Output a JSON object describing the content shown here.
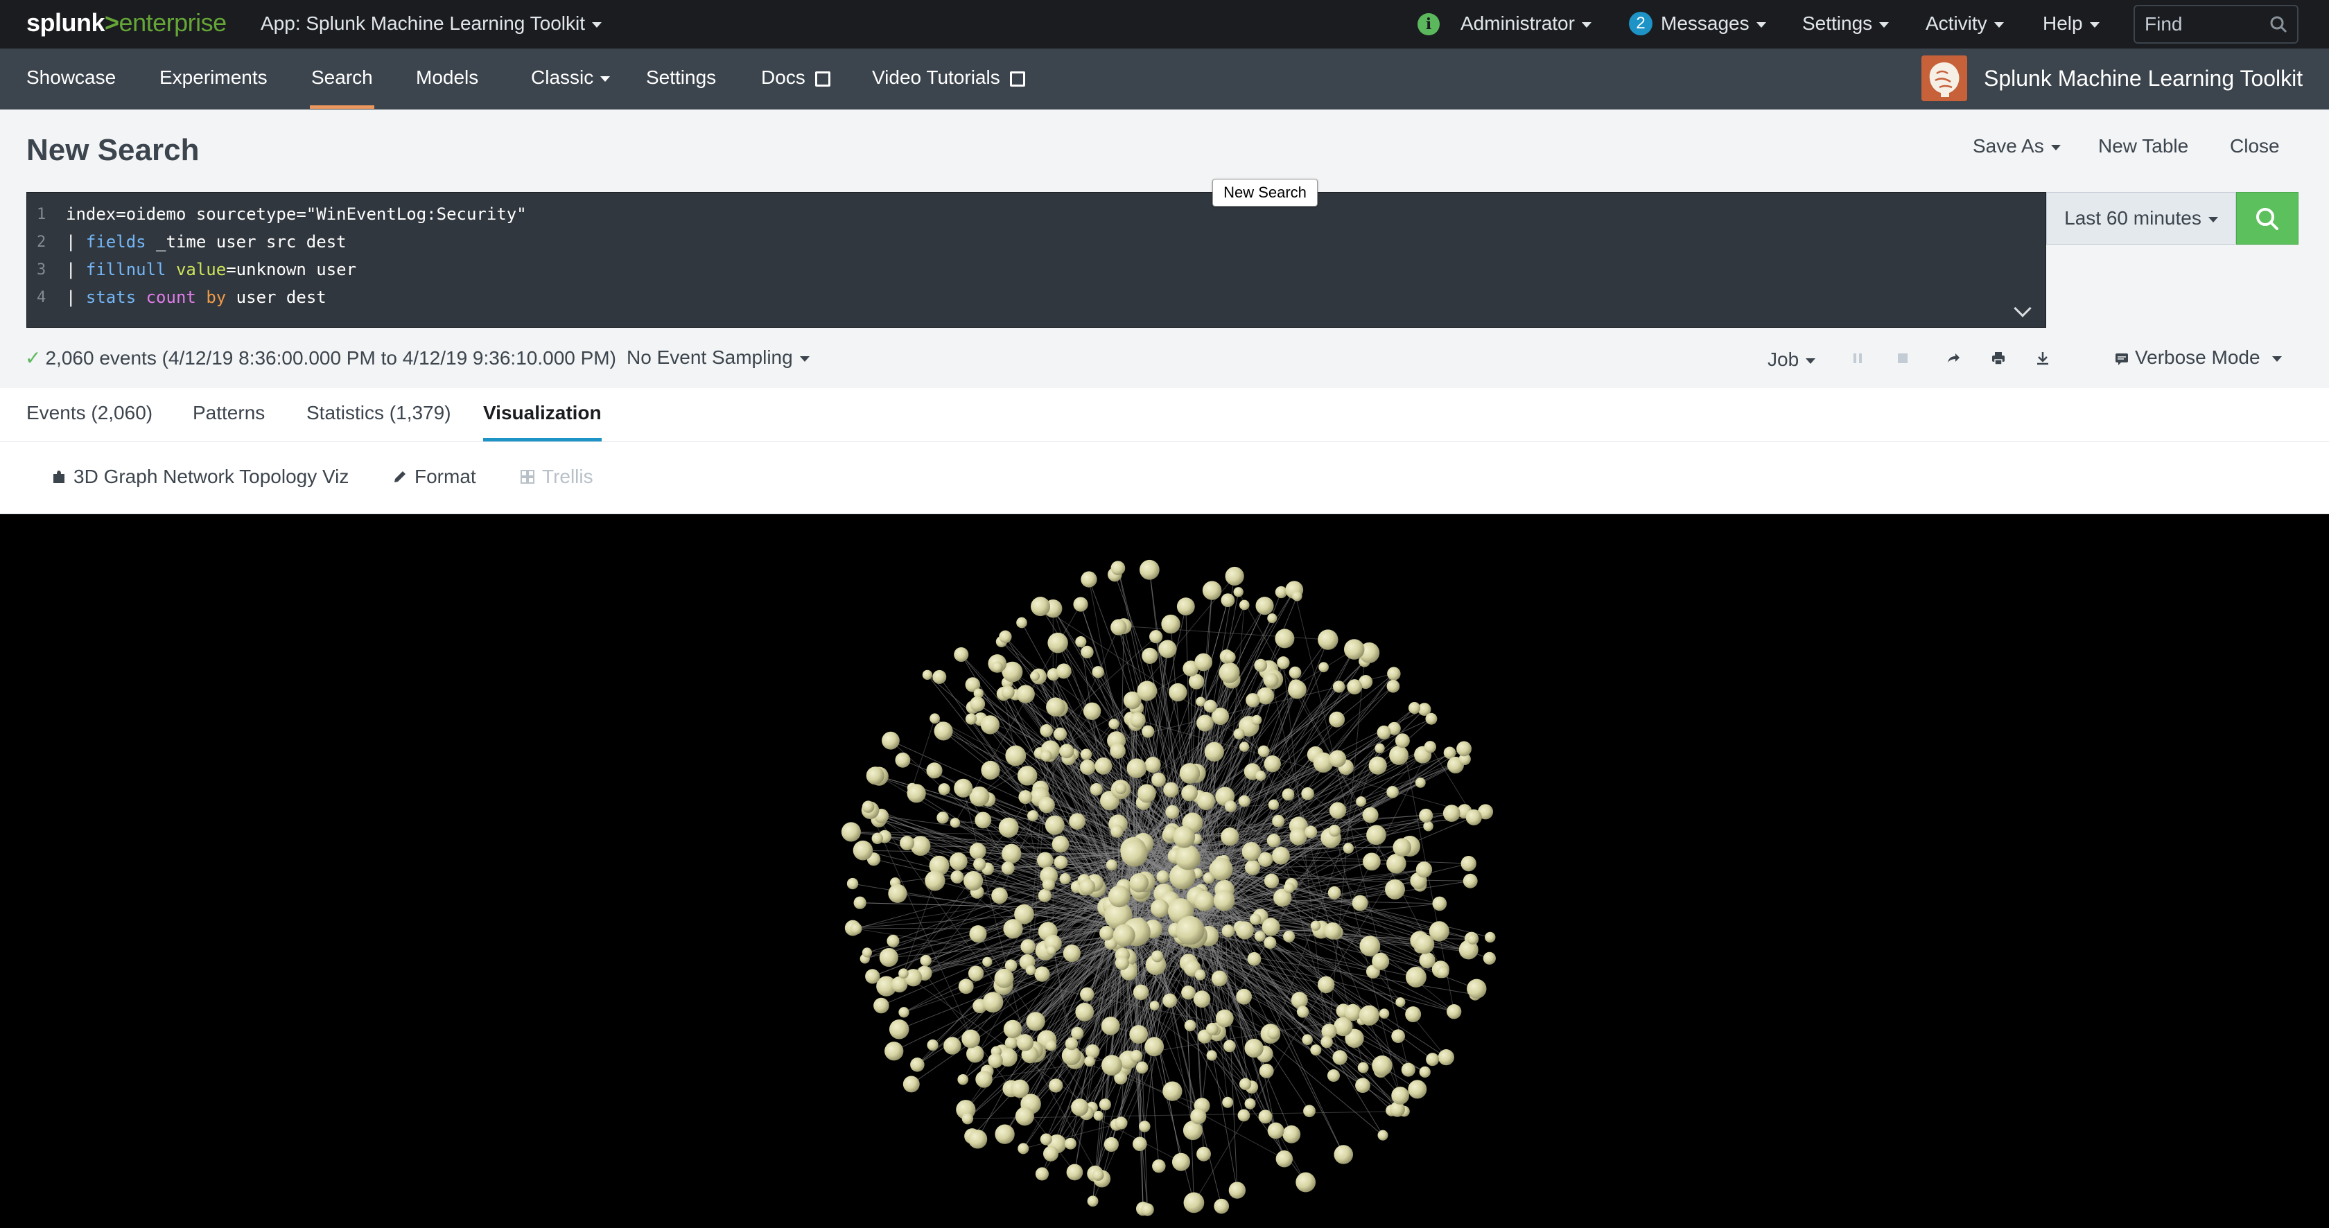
{
  "topbar": {
    "logo_splunk": "splunk",
    "logo_gt": ">",
    "logo_enterprise": "enterprise",
    "app_label": "App: Splunk Machine Learning Toolkit",
    "status_icon_glyph": "i",
    "user_label": "Administrator",
    "messages_count": "2",
    "messages_label": "Messages",
    "settings_label": "Settings",
    "activity_label": "Activity",
    "help_label": "Help",
    "find_placeholder": "Find"
  },
  "appnav": {
    "items": [
      "Showcase",
      "Experiments",
      "Search",
      "Models",
      "Classic",
      "Settings",
      "Docs",
      "Video Tutorials"
    ],
    "active": "Search",
    "app_title": "Splunk Machine Learning Toolkit"
  },
  "header": {
    "title": "New Search",
    "save_as": "Save As",
    "new_table": "New Table",
    "close": "Close",
    "tooltip": "New Search"
  },
  "editor": {
    "line_numbers": [
      "1",
      "2",
      "3",
      "4"
    ],
    "line1": "index=oidemo sourcetype=\"WinEventLog:Security\"",
    "line2_pipe": "| ",
    "line2_cmd": "fields",
    "line2_rest": " _time user src dest",
    "line3_pipe": "| ",
    "line3_cmd": "fillnull",
    "line3_sp": " ",
    "line3_arg": "value",
    "line3_rest": "=unknown user",
    "line4_pipe": "| ",
    "line4_cmd": "stats",
    "line4_sp": " ",
    "line4_fn": "count",
    "line4_sp2": " ",
    "line4_mod": "by",
    "line4_rest": " user dest"
  },
  "time_picker": "Last 60 minutes",
  "job_bar": {
    "status": "2,060 events (4/12/19 8:36:00.000 PM to 4/12/19 9:36:10.000 PM)",
    "sampling": "No Event Sampling",
    "job": "Job",
    "mode": "Verbose Mode"
  },
  "tabs": [
    {
      "label": "Events (2,060)"
    },
    {
      "label": "Patterns"
    },
    {
      "label": "Statistics (1,379)"
    },
    {
      "label": "Visualization"
    }
  ],
  "active_tab": "Visualization",
  "viz_toolbar": {
    "viz_type": "3D Graph Network Topology Viz",
    "format": "Format",
    "trellis": "Trellis"
  },
  "graph": {
    "node_color": "#d6d4a3",
    "edge_color": "#8a8a8a",
    "background": "#000000"
  }
}
